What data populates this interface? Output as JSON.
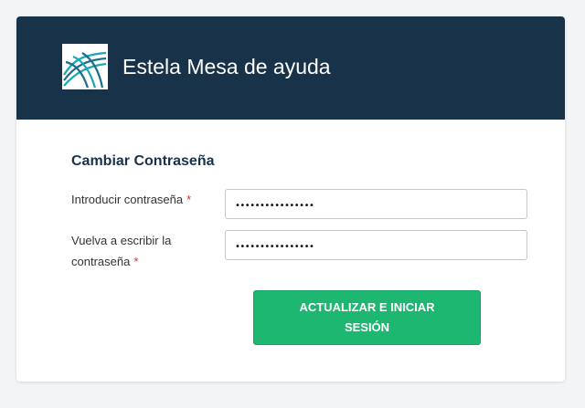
{
  "header": {
    "title": "Estela Mesa de ayuda",
    "logo_icon": "waves-logo-icon",
    "background": "#18324a"
  },
  "form": {
    "title": "Cambiar Contraseña",
    "fields": [
      {
        "label": "Introducir contraseña",
        "required_mark": "*",
        "value": "••••••••••••••••"
      },
      {
        "label_line1": "Vuelva a escribir la",
        "label_line2": "contraseña",
        "required_mark": "*",
        "value": "••••••••••••••••"
      }
    ],
    "submit_label": "ACTUALIZAR E INICIAR SESIÓN"
  },
  "colors": {
    "accent": "#1db772",
    "required": "#d32f2f",
    "title": "#18324a"
  }
}
